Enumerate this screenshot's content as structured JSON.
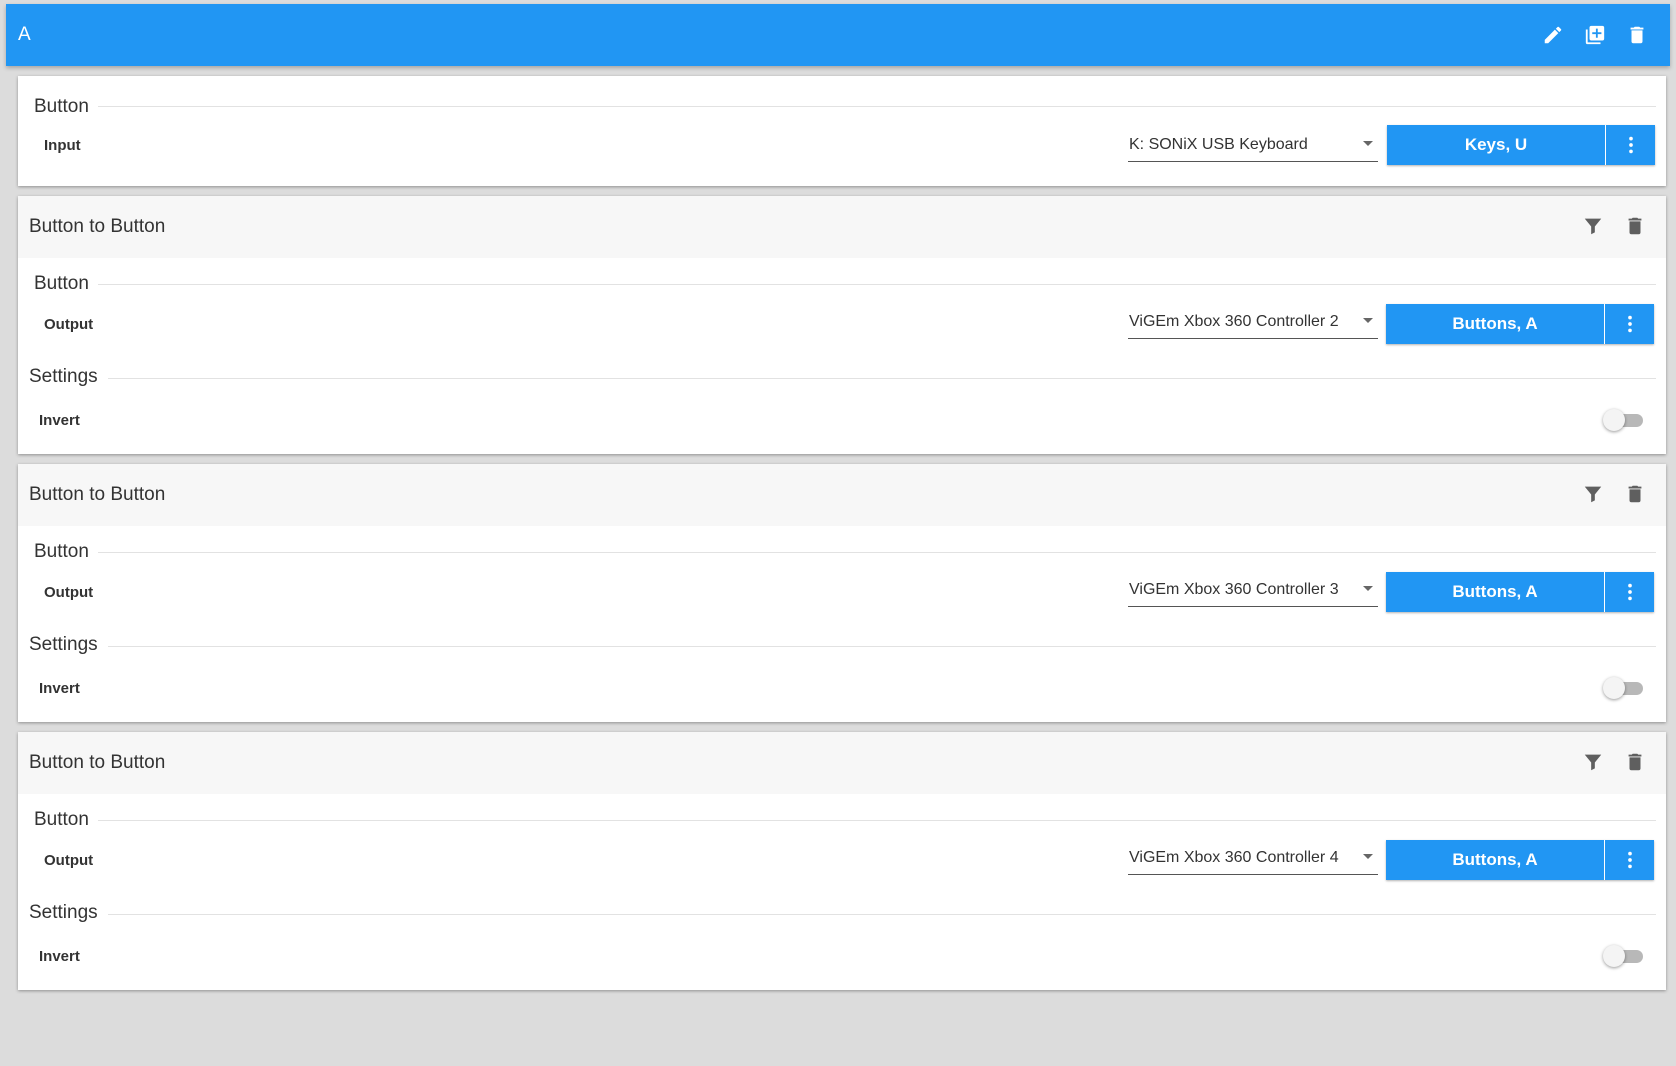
{
  "header": {
    "title": "A",
    "actions": [
      {
        "icon": "pencil-icon"
      },
      {
        "icon": "add-box-icon"
      },
      {
        "icon": "trash-icon"
      }
    ]
  },
  "input_card": {
    "section_label": "Button",
    "row_label": "Input",
    "device": "K: SONiX USB Keyboard",
    "binding": "Keys, U"
  },
  "plugins": [
    {
      "title": "Button to Button",
      "section_label": "Button",
      "row_label": "Output",
      "device": "ViGEm Xbox 360 Controller 2",
      "binding": "Buttons, A",
      "settings_label": "Settings",
      "invert_label": "Invert",
      "invert": false
    },
    {
      "title": "Button to Button",
      "section_label": "Button",
      "row_label": "Output",
      "device": "ViGEm Xbox 360 Controller 3",
      "binding": "Buttons, A",
      "settings_label": "Settings",
      "invert_label": "Invert",
      "invert": false
    },
    {
      "title": "Button to Button",
      "section_label": "Button",
      "row_label": "Output",
      "device": "ViGEm Xbox 360 Controller 4",
      "binding": "Buttons, A",
      "settings_label": "Settings",
      "invert_label": "Invert",
      "invert": false
    }
  ],
  "colors": {
    "accent": "#2196f3",
    "icon_gray": "#5f5f5f",
    "card_header_bg": "#f7f7f7"
  }
}
